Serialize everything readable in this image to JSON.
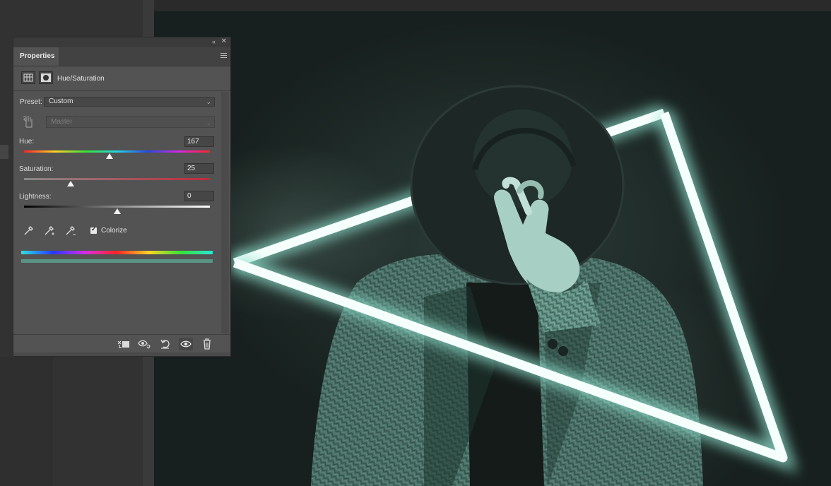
{
  "panel": {
    "tab_label": "Properties",
    "adjustment_title": "Hue/Saturation",
    "collapse_icon": "double-chevron-left-icon",
    "close_icon": "close-icon",
    "menu_icon": "panel-menu-icon"
  },
  "preset": {
    "label": "Preset:",
    "value": "Custom"
  },
  "channel": {
    "value": "Master"
  },
  "hue": {
    "label": "Hue:",
    "value": "167",
    "slider_fraction": 0.46
  },
  "saturation": {
    "label": "Saturation:",
    "value": "25",
    "slider_fraction": 0.25
  },
  "lightness": {
    "label": "Lightness:",
    "value": "0",
    "slider_fraction": 0.5
  },
  "colorize": {
    "label": "Colorize",
    "checked": true
  },
  "colors": {
    "colorized_bar": "#5a9484",
    "panel_bg": "#535353",
    "neon_glow": "#9fe6d6"
  },
  "footer_icons": [
    "clip-to-layer-icon",
    "view-previous-state-icon",
    "reset-icon",
    "visibility-eye-icon",
    "trash-icon"
  ]
}
